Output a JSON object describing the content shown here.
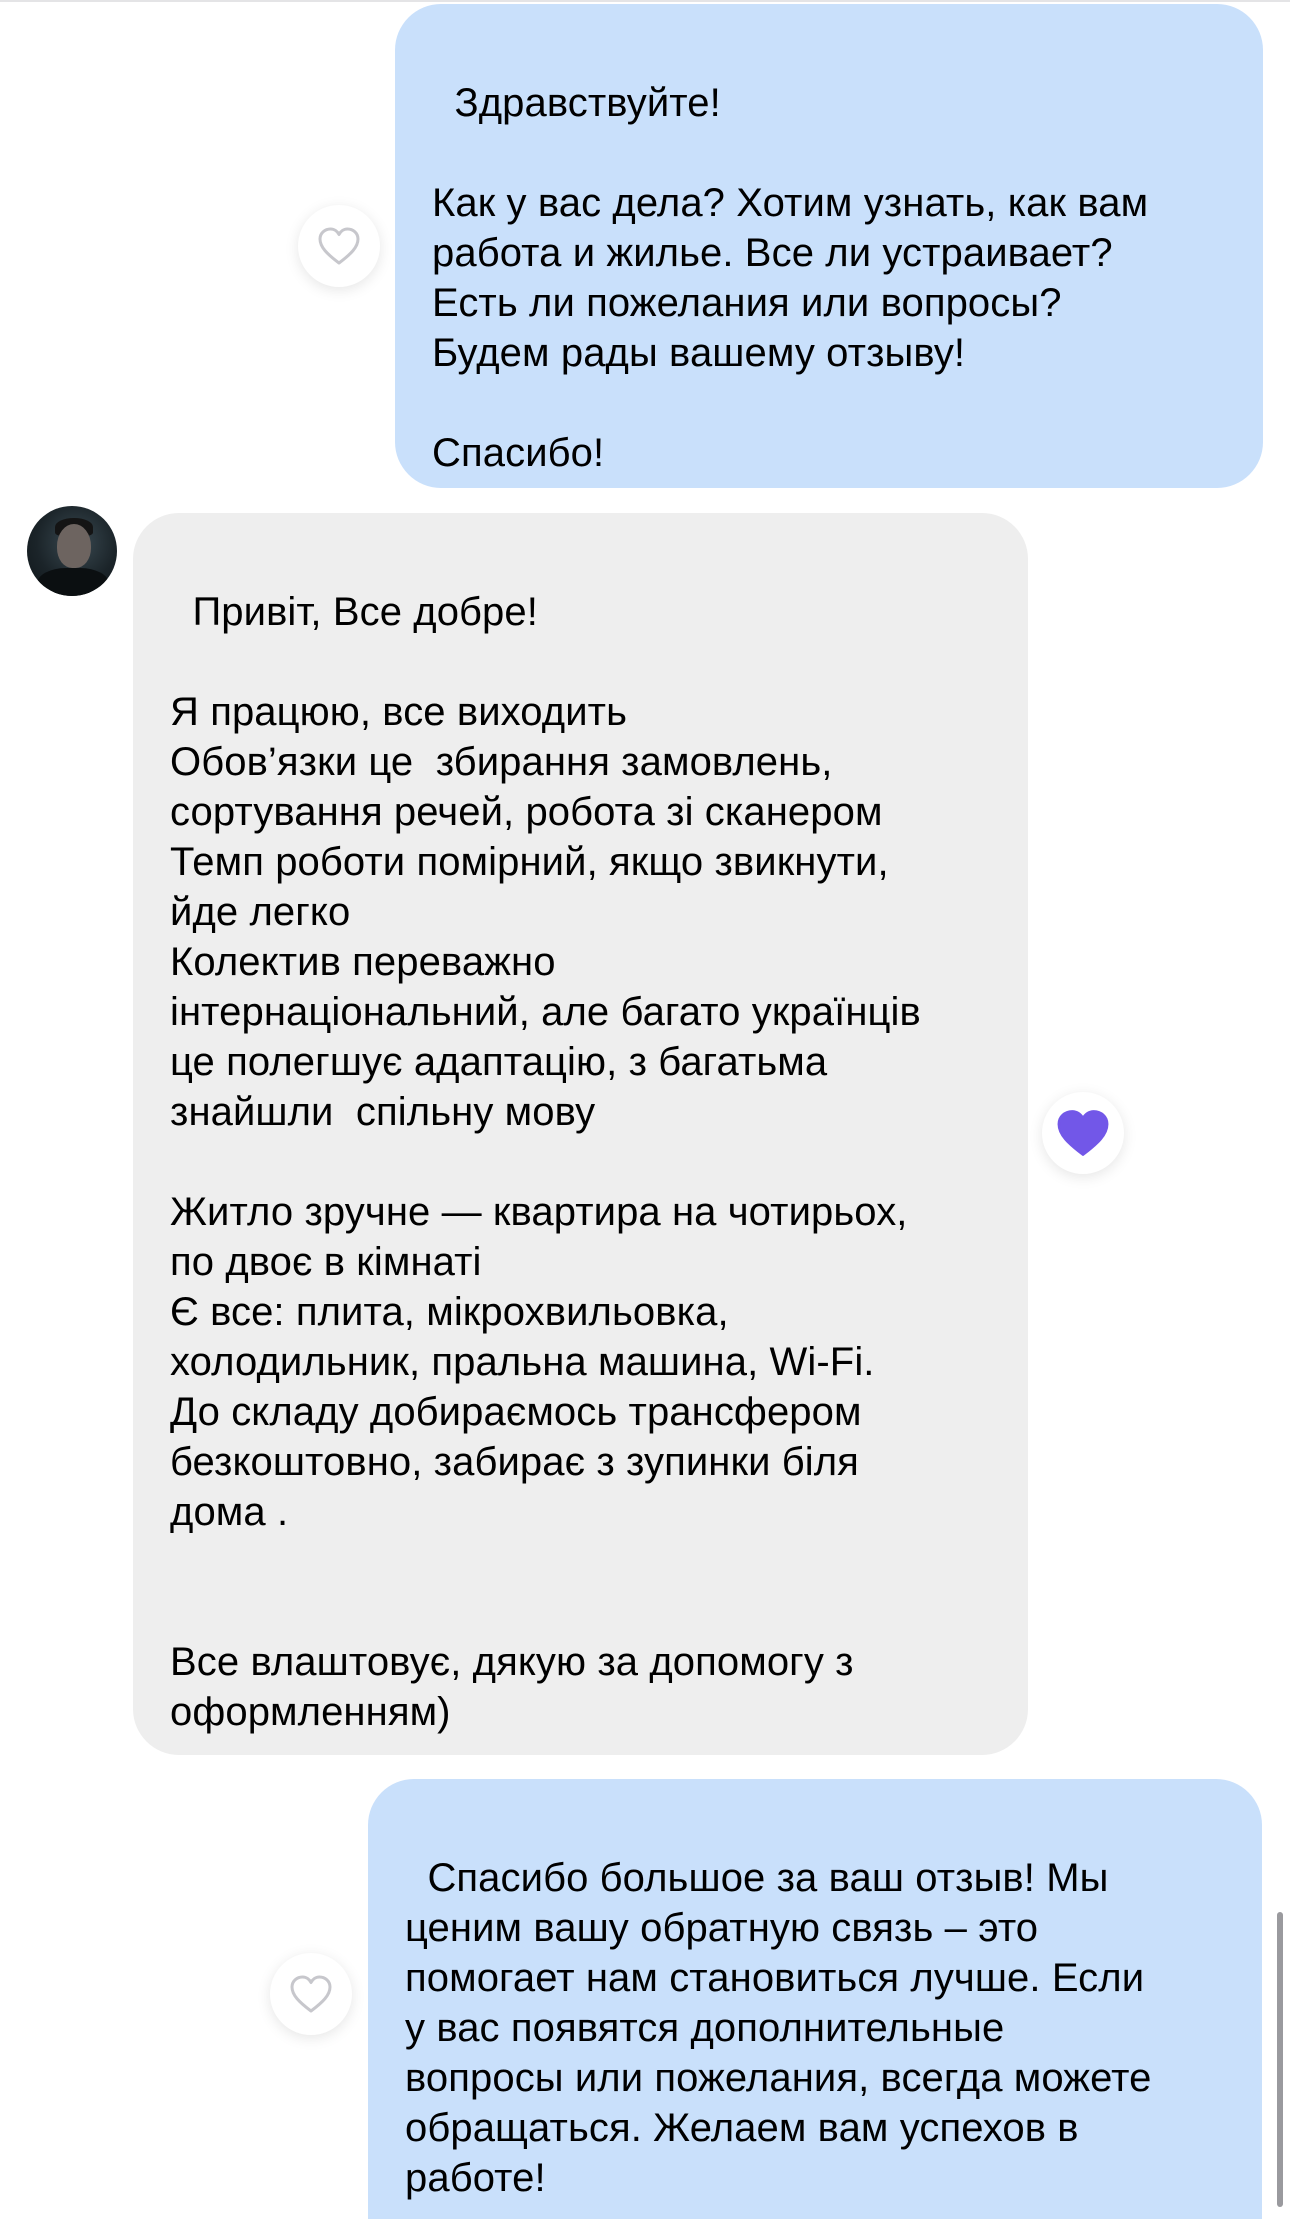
{
  "messages": [
    {
      "direction": "outgoing",
      "text": "Здравствуйте!\n\nКак у вас дела? Хотим узнать, как вам\nработа и жилье. Все ли устраивает?\nЕсть ли пожелания или вопросы?\nБудем рады вашему отзыву!\n\nСпасибо!",
      "liked": false
    },
    {
      "direction": "incoming",
      "text": "Привіт, Все добре!\n\nЯ працюю, все виходить\nОбов’язки це  збирання замовлень,\nсортування речей, робота зі сканером\nТемп роботи помірний, якщо звикнути,\nйде легко\nКолектив переважно\nінтернаціональний, але багато українців\nце полегшує адаптацію, з багатьма\nзнайшли  спільну мову\n\nЖитло зручне — квартира на чотирьох,\nпо двоє в кімнаті\nЄ все: плита, мікрохвильовка,\nхолодильник, пральна машина, Wi-Fi.\nДо складу добираємось трансфером\nбезкоштовно, забирає з зупинки біля\nдома .\n\n\nВсе влаштовує, дякую за допомогу з\nоформленням)",
      "liked": true
    },
    {
      "direction": "outgoing",
      "text": "Спасибо большое за ваш отзыв! Мы\nценим вашу обратную связь – это\nпомогает нам становиться лучше. Если\nу вас появятся дополнительные\nвопросы или пожелания, всегда можете\nобращаться. Желаем вам успехов в\nработе!",
      "liked": false
    }
  ],
  "icons": {
    "like_empty": "heart-outline-icon",
    "like_filled": "heart-filled-icon",
    "avatar": "user-avatar"
  },
  "colors": {
    "outgoing_bubble": "#c9e0fb",
    "incoming_bubble": "#eeeeee",
    "heart_filled": "#7257e8",
    "heart_outline": "#c7c7cc"
  }
}
